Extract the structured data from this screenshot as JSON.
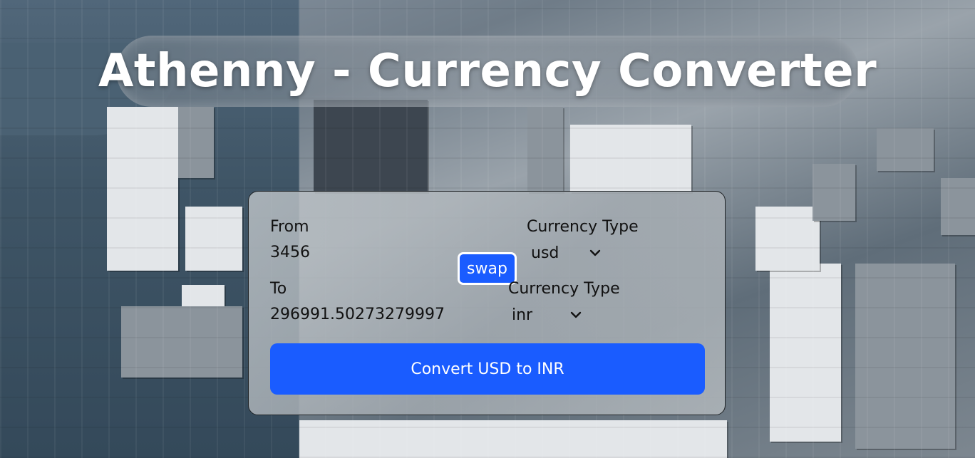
{
  "app": {
    "title": "Athenny - Currency Converter"
  },
  "converter": {
    "from": {
      "label": "From",
      "amount": "3456"
    },
    "from_currency": {
      "label": "Currency Type",
      "selected": "usd"
    },
    "to": {
      "label": "To",
      "amount": "296991.50273279997"
    },
    "to_currency": {
      "label": "Currency Type",
      "selected": "inr"
    },
    "swap_label": "swap",
    "convert_label": "Convert USD to INR"
  },
  "colors": {
    "accent": "#1a5cff",
    "title_text": "#ffffff"
  },
  "icons": {
    "dropdown": "chevron-down-icon"
  }
}
